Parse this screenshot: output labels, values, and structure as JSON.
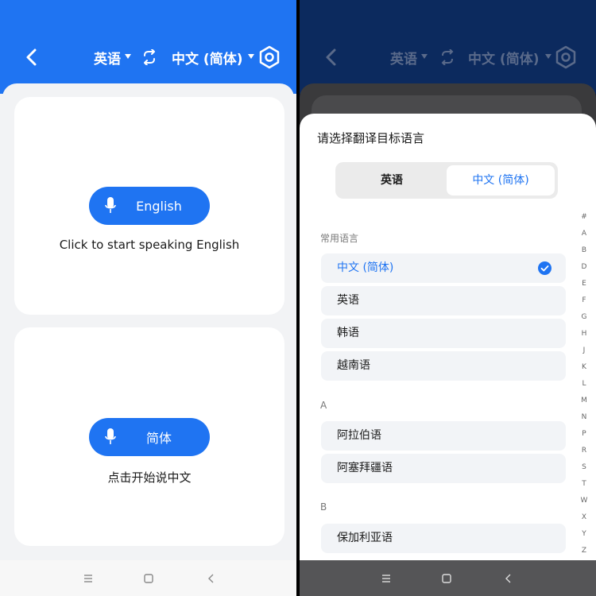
{
  "left": {
    "header": {
      "source_lang": "英语",
      "target_lang": "中文 (简体)"
    },
    "english_card": {
      "button_label": "English",
      "hint": "Click to start speaking English"
    },
    "chinese_card": {
      "button_label": "简体",
      "hint": "点击开始说中文"
    },
    "navbar": {
      "icons": [
        "menu-icon",
        "home-icon",
        "back-icon"
      ]
    }
  },
  "right": {
    "header": {
      "source_lang": "英语",
      "target_lang": "中文 (简体)"
    },
    "sheet": {
      "title": "请选择翻译目标语言",
      "segment": {
        "option_a": "英语",
        "option_b": "中文 (简体)",
        "selected": "option_b"
      },
      "sections": [
        {
          "label": "常用语言",
          "items": [
            "中文 (简体)",
            "英语",
            "韩语",
            "越南语"
          ]
        },
        {
          "label": "A",
          "items": [
            "阿拉伯语",
            "阿塞拜疆语"
          ]
        },
        {
          "label": "B",
          "items": [
            "保加利亚语"
          ]
        }
      ],
      "selected_item": "中文 (简体)",
      "alphabet": [
        "#",
        "A",
        "B",
        "D",
        "E",
        "F",
        "G",
        "H",
        "J",
        "K",
        "L",
        "M",
        "N",
        "P",
        "R",
        "S",
        "T",
        "W",
        "X",
        "Y",
        "Z"
      ]
    }
  },
  "colors": {
    "accent": "#1f74f2",
    "background": "#f2f3f5"
  }
}
